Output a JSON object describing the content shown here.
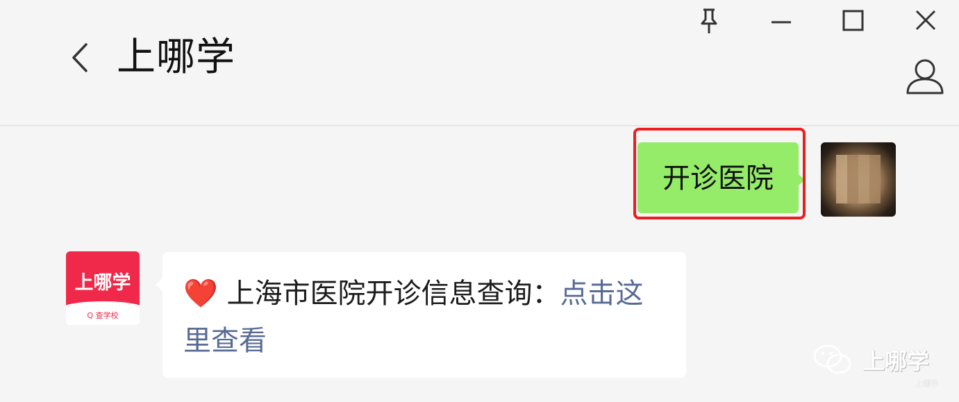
{
  "header": {
    "title": "上哪学"
  },
  "window_controls": [
    "pin-icon",
    "minimize-icon",
    "maximize-icon",
    "close-icon"
  ],
  "messages": {
    "outgoing": {
      "text": "开诊医院"
    },
    "incoming": {
      "emoji": "❤️",
      "text": "上海市医院开诊信息查询：",
      "link": "点击这里查看"
    }
  },
  "bot_avatar": {
    "logo_text": "上哪学",
    "sub_text": "Q 查学校",
    "brand_color": "#f0294a"
  },
  "watermark": {
    "text": "上哪学",
    "small_text": "上哪学"
  },
  "colors": {
    "outgoing_bubble": "#95ec69",
    "highlight_border": "#ee1d1d",
    "link": "#576b95"
  }
}
